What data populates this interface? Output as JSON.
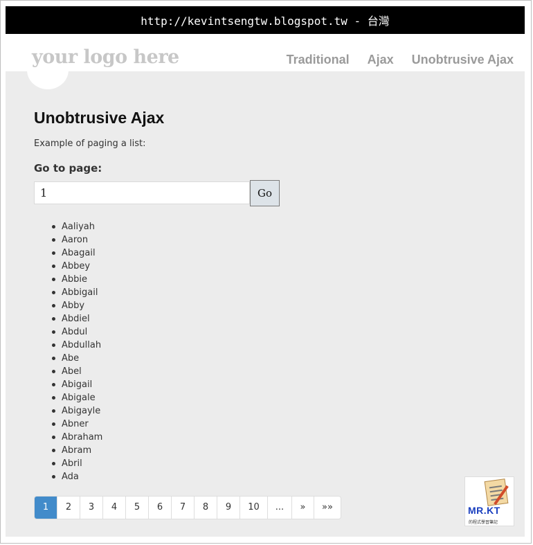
{
  "banner": {
    "text": "http://kevintsengtw.blogspot.tw - 台灣"
  },
  "header": {
    "logo_text": "your logo here",
    "nav": [
      "Traditional",
      "Ajax",
      "Unobtrusive Ajax"
    ]
  },
  "main": {
    "title": "Unobtrusive Ajax",
    "intro": "Example of paging a list:",
    "goto_label": "Go to page:",
    "page_input_value": "1",
    "go_button": "Go",
    "names": [
      "Aaliyah",
      "Aaron",
      "Abagail",
      "Abbey",
      "Abbie",
      "Abbigail",
      "Abby",
      "Abdiel",
      "Abdul",
      "Abdullah",
      "Abe",
      "Abel",
      "Abigail",
      "Abigale",
      "Abigayle",
      "Abner",
      "Abraham",
      "Abram",
      "Abril",
      "Ada"
    ]
  },
  "pager": {
    "pages": [
      "1",
      "2",
      "3",
      "4",
      "5",
      "6",
      "7",
      "8",
      "9",
      "10",
      "...",
      "»",
      "»»"
    ],
    "active": "1",
    "active_color": "#428bca"
  },
  "watermark": {
    "brand": "MR.KT",
    "sub": "的程式學習筆記"
  }
}
